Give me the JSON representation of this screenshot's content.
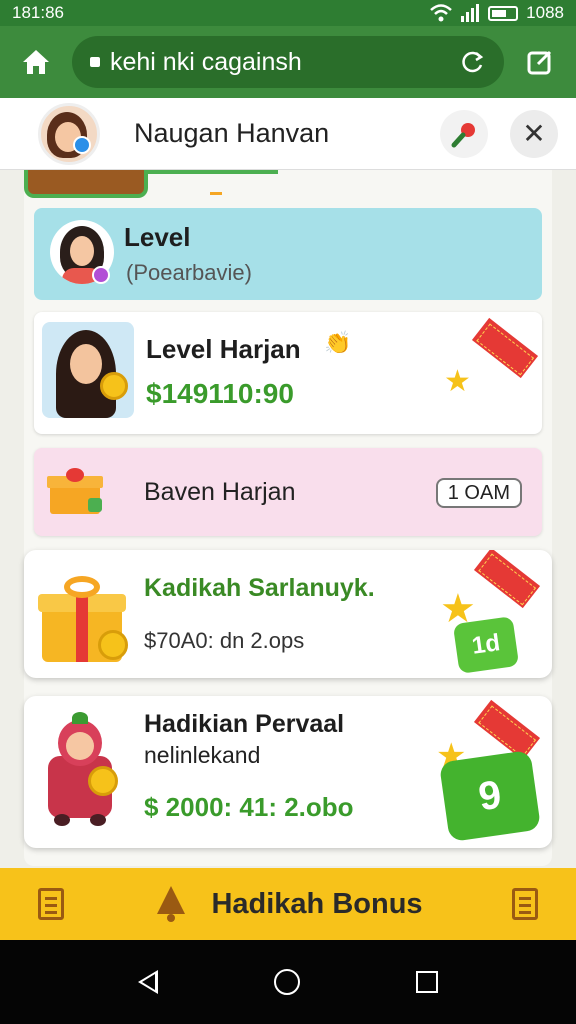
{
  "status_bar": {
    "time_left": "181:86",
    "time_right": "1088",
    "wifi_icon": "wifi-icon",
    "signal_icon": "signal-icon",
    "battery_icon": "battery-icon"
  },
  "browser": {
    "url": "kehi nki cagainsh",
    "home_icon": "home-icon",
    "reload_icon": "reload-icon",
    "edit_icon": "edit-icon"
  },
  "profile": {
    "name": "Naugan Hanvan",
    "mic_icon": "microphone-icon",
    "close_label": "✕"
  },
  "cards": [
    {
      "title": "Level",
      "subtitle": "(Poearbavie)"
    },
    {
      "title": "Level Harjan",
      "amount": "$149110:90"
    },
    {
      "title": "Baven Harjan",
      "time": "1 OAM"
    },
    {
      "title": "Kadikah Sarlanuyk.",
      "subtitle": "$70A0: dn 2.ops",
      "tile_label": "1d"
    },
    {
      "title": "Hadikian Pervaal",
      "subtitle": "nelinlekand",
      "amount": "$ 2000: 41: 2.obo",
      "tile_label": "9"
    }
  ],
  "bonus_bar": {
    "label": "Hadikah Bonus"
  },
  "colors": {
    "status_green": "#2e7d32",
    "browser_green": "#3d8b3d",
    "money_green": "#3a9b2b",
    "bonus_yellow": "#f7c21a",
    "card_blue": "#a6e0e8",
    "card_pink": "#f9deec"
  }
}
